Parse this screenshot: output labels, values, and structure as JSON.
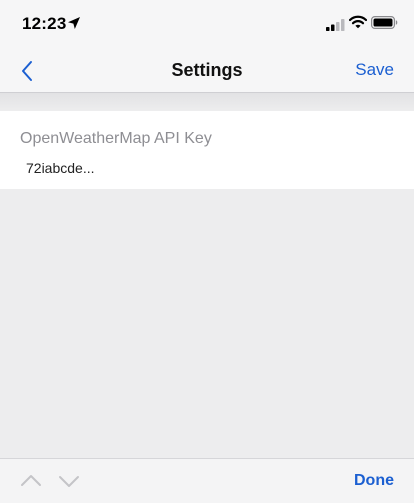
{
  "status_bar": {
    "time": "12:23",
    "icons": [
      "location-arrow-icon",
      "cellular-signal-icon",
      "wifi-icon",
      "battery-icon"
    ]
  },
  "nav_bar": {
    "back_icon": "chevron-left-icon",
    "title": "Settings",
    "save_label": "Save"
  },
  "form": {
    "api_key": {
      "label": "OpenWeatherMap API Key",
      "value": "72iabcde..."
    }
  },
  "keyboard_toolbar": {
    "prev_icon": "chevron-up-icon",
    "next_icon": "chevron-down-icon",
    "done_label": "Done"
  },
  "colors": {
    "accent": "#1b5fd1",
    "background": "#ededee",
    "bar": "#f6f6f7",
    "label_gray": "#8e8e93"
  }
}
